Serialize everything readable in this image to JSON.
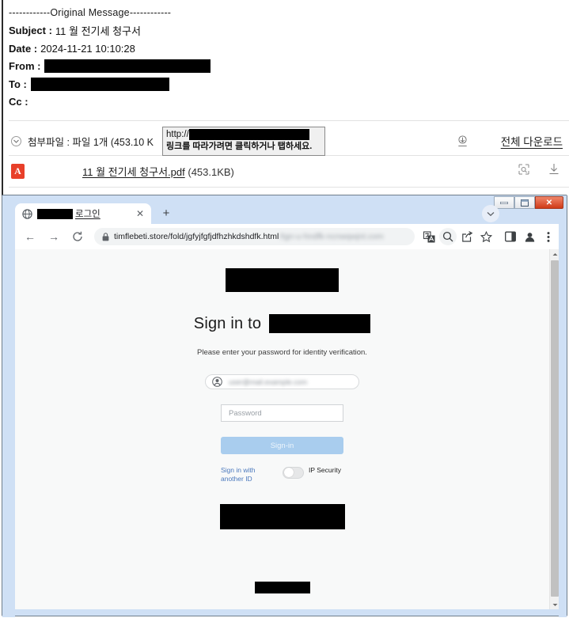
{
  "email": {
    "original_message_divider": "------------Original Message------------",
    "headers": [
      {
        "label": "Subject :",
        "value": "11 월 전기세 청구서",
        "redacted": false
      },
      {
        "label": "Date :",
        "value": "2024-11-21 10:10:28",
        "redacted": false
      },
      {
        "label": "From :",
        "value": "",
        "redacted": true,
        "redact_width": 210
      },
      {
        "label": "To :",
        "value": "",
        "redacted": true,
        "redact_width": 175
      },
      {
        "label": "Cc :",
        "value": "",
        "redacted": false
      }
    ],
    "attachment_header": "첨부파일 : 파일 1개 (453.10 K",
    "download_all_label": "전체 다운로드",
    "file": {
      "name": "11 월 전기세 청구서.pdf",
      "size": "(453.1KB)",
      "icon": "pdf-icon",
      "icon_glyph": "A"
    },
    "tooltip": {
      "url_prefix": "http://",
      "url_redacted": true,
      "hint": "링크를 따라가려면 클릭하거나 탭하세요."
    }
  },
  "browser": {
    "window_controls": {
      "minimize": "—",
      "maximize": "❐",
      "close": "✕"
    },
    "tab": {
      "title_suffix": "로그인",
      "title_redacted": true,
      "favicon": "globe-icon",
      "close_glyph": "✕"
    },
    "new_tab_glyph": "+",
    "toolbar": {
      "back_glyph": "←",
      "forward_glyph": "→",
      "reload_glyph": "⟳",
      "url_visible": "timflebeti.store/fold/jgfyjfgfjdfhzhkdshdfk.html",
      "url_blurred": "/tgn-u-hndfk-ncnwqwjnt.com",
      "icons": [
        "translate-icon",
        "search-icon",
        "share-icon",
        "bookmark-star-icon",
        "side-panel-icon",
        "profile-icon",
        "browser-menu-icon"
      ]
    }
  },
  "page": {
    "logo_redacted": true,
    "signin_prefix": "Sign in to",
    "signin_brand_redacted": true,
    "subtitle": "Please enter your password for identity verification.",
    "account_chip": {
      "avatar": "person-icon",
      "email_blurred": "user@mail.example.com"
    },
    "password_placeholder": "Password",
    "signin_button_label": "Sign-in",
    "another_id_label": "Sign in with another ID",
    "ip_security_label": "IP Security",
    "ip_security_on": false,
    "banner_redacted": true,
    "footer_redacted": true
  },
  "colors": {
    "accent_blue": "#a9cdee",
    "link_blue": "#4a78bd",
    "pdf_red": "#e8402a",
    "redaction": "#000000",
    "window_chrome": "#cfe0f5"
  }
}
